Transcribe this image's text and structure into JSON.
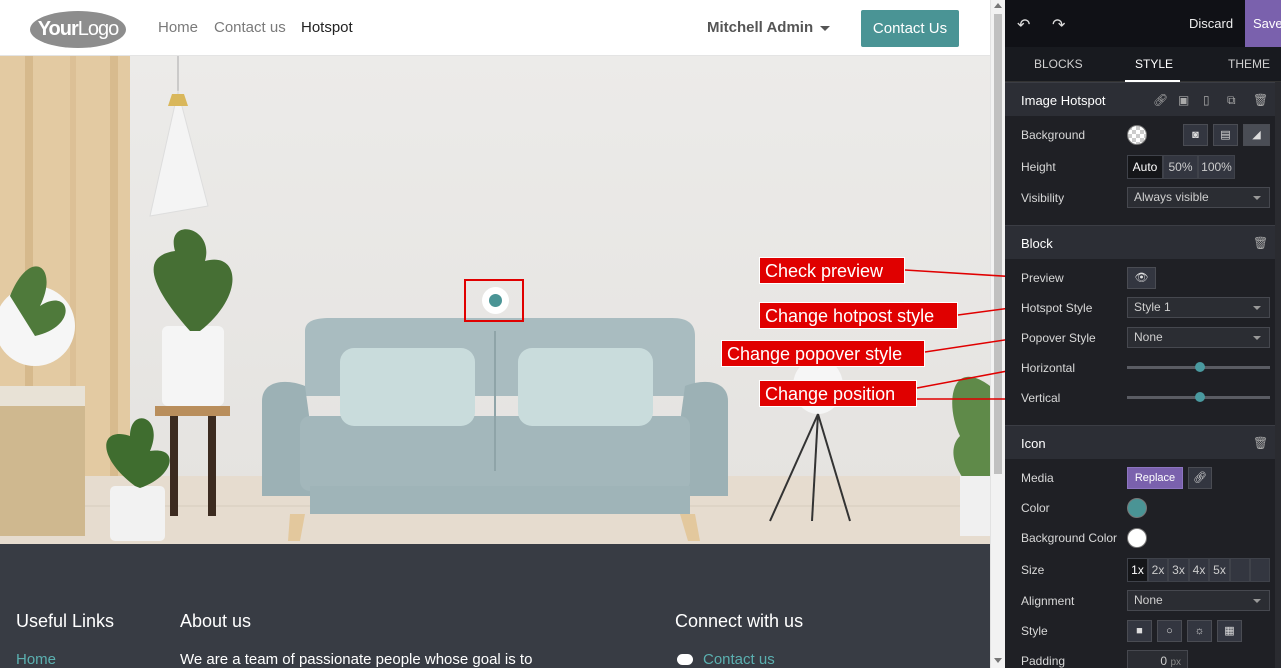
{
  "navbar": {
    "logo_bold": "Your",
    "logo_rest": "Logo",
    "links": [
      "Home",
      "Contact us",
      "Hotspot"
    ],
    "user": "Mitchell Admin",
    "cta": "Contact Us"
  },
  "footer": {
    "col1_title": "Useful Links",
    "col1_link": "Home",
    "col2_title": "About us",
    "col2_text": "We are a team of passionate people whose goal is to",
    "col3_title": "Connect with us",
    "col3_link": "Contact us"
  },
  "annotations": {
    "a1": "Check preview",
    "a2": "Change hotpost style",
    "a3": "Change popover style",
    "a4": "Change position"
  },
  "panel": {
    "discard": "Discard",
    "save": "Save",
    "tabs": [
      "BLOCKS",
      "STYLE",
      "THEME"
    ],
    "s1": {
      "title": "Image Hotspot",
      "background_label": "Background",
      "height_label": "Height",
      "height_options": [
        "Auto",
        "50%",
        "100%"
      ],
      "visibility_label": "Visibility",
      "visibility_value": "Always visible"
    },
    "s2": {
      "title": "Block",
      "preview_label": "Preview",
      "hotspot_style_label": "Hotspot Style",
      "hotspot_style_value": "Style 1",
      "popover_style_label": "Popover Style",
      "popover_style_value": "None",
      "horizontal_label": "Horizontal",
      "vertical_label": "Vertical"
    },
    "s3": {
      "title": "Icon",
      "media_label": "Media",
      "replace": "Replace",
      "color_label": "Color",
      "bg_color_label": "Background Color",
      "size_label": "Size",
      "size_options": [
        "1x",
        "2x",
        "3x",
        "4x",
        "5x"
      ],
      "alignment_label": "Alignment",
      "alignment_value": "None",
      "style_label": "Style",
      "padding_label": "Padding",
      "padding_value": "0",
      "padding_unit": "px"
    }
  },
  "colors": {
    "accent": "#4a9495",
    "save": "#7a61ad",
    "annotation": "#e00000",
    "footer_bg": "#383c44",
    "panel_bg": "#1f2025"
  }
}
